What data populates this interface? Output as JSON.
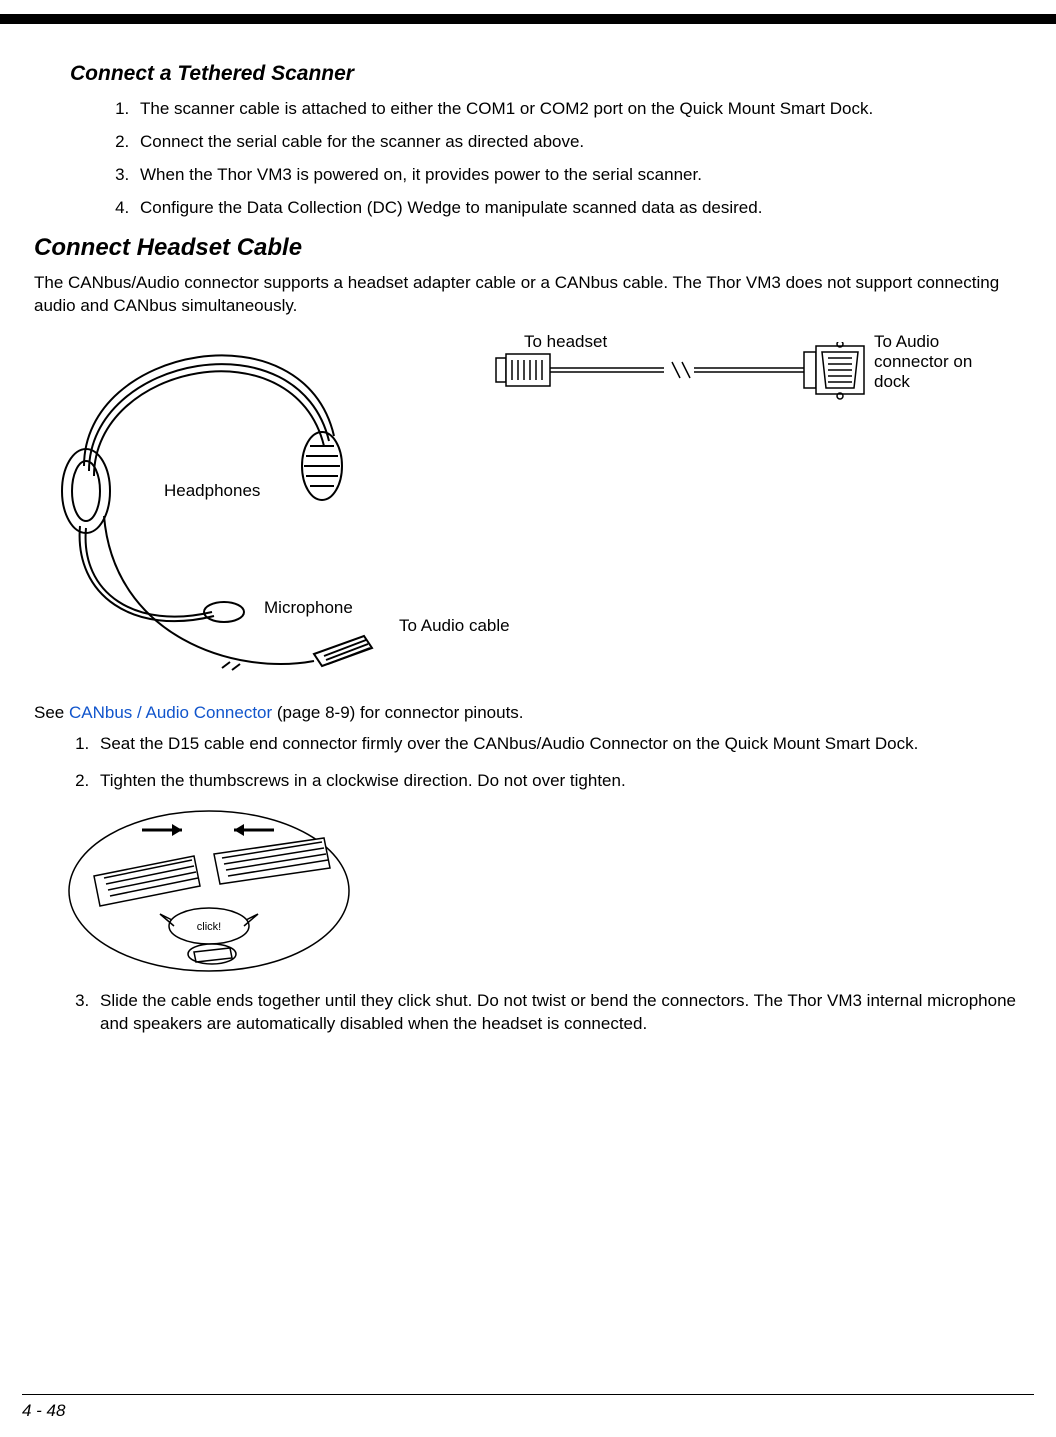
{
  "section1": {
    "title": "Connect a Tethered Scanner",
    "steps": [
      "The scanner cable is attached to either the COM1 or COM2 port on the Quick Mount Smart Dock.",
      "Connect the serial cable for the scanner as directed above.",
      "When the Thor VM3 is powered on, it provides power to the serial scanner.",
      "Configure the Data Collection (DC) Wedge to manipulate scanned data as desired."
    ]
  },
  "section2": {
    "title": "Connect Headset Cable",
    "intro": "The CANbus/Audio connector supports a headset adapter cable or a CANbus cable.  The Thor VM3 does not support connecting audio and CANbus simultaneously.",
    "labels": {
      "headphones": "Headphones",
      "microphone": "Microphone",
      "to_audio_cable": "To Audio cable",
      "to_headset": "To headset",
      "to_audio_connector": "To Audio connector on dock"
    },
    "see_prefix": "See ",
    "see_link": "CANbus / Audio Connector",
    "see_suffix": " (page 8-9) for connector pinouts.",
    "steps": [
      "Seat the D15 cable end connector firmly over the CANbus/Audio Connector on the Quick Mount Smart Dock.",
      "Tighten the thumbscrews in a clockwise direction.  Do not over tighten.",
      "Slide the cable ends together until they click shut.  Do not twist or bend the connectors.  The Thor VM3 internal microphone and speakers are automatically disabled when the headset is connected."
    ],
    "click_label": "click!"
  },
  "page_number": "4 - 48"
}
